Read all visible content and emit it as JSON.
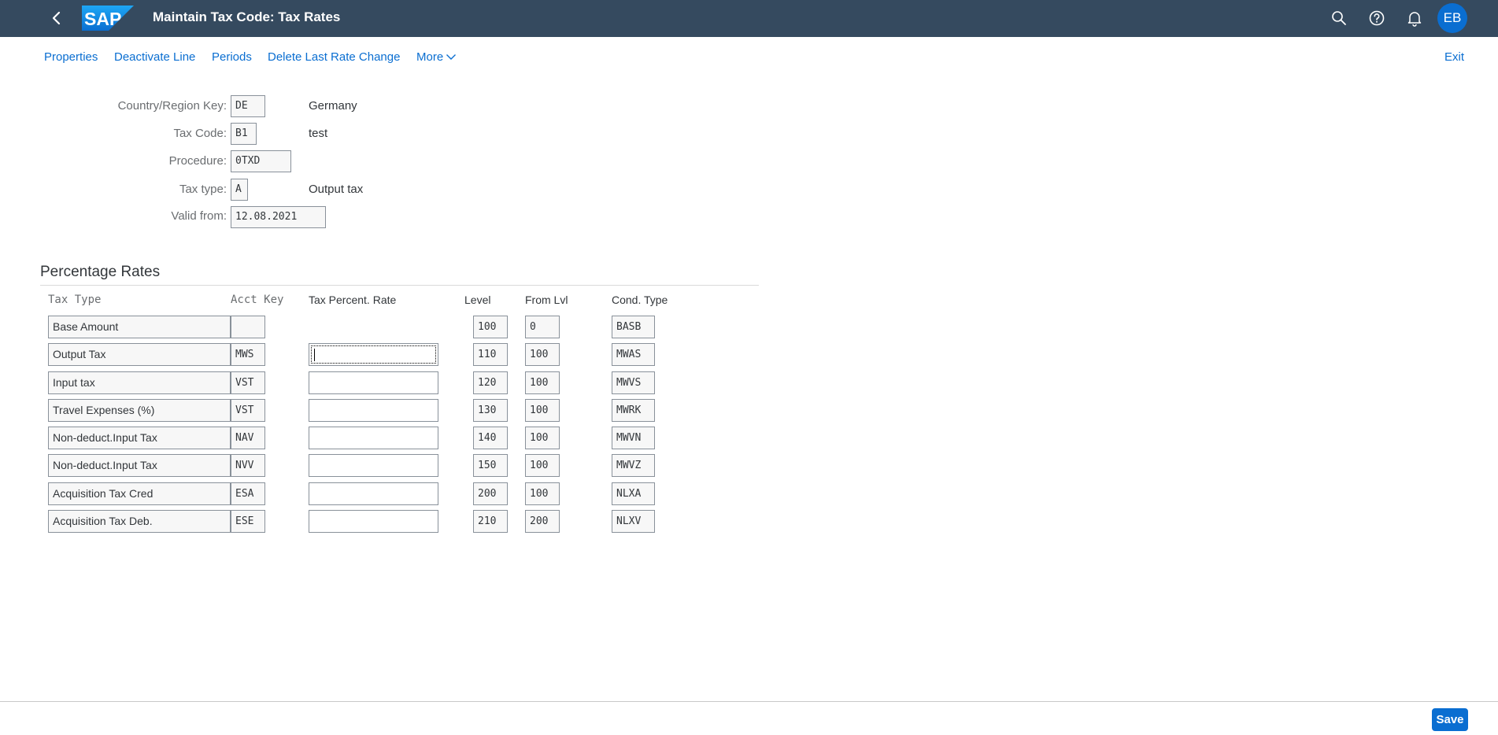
{
  "shell": {
    "title": "Maintain Tax Code: Tax Rates",
    "logo_text": "SAP",
    "avatar_initials": "EB",
    "icons": [
      "back-icon",
      "search-icon",
      "help-icon",
      "notification-icon"
    ],
    "colors": {
      "shellbar": "#354a5f",
      "accent": "#0a6ed1"
    }
  },
  "toolbar": {
    "properties": "Properties",
    "deactivate_line": "Deactivate Line",
    "periods": "Periods",
    "delete_last_rate_change": "Delete Last Rate Change",
    "more": "More",
    "exit": "Exit"
  },
  "header": {
    "country_label": "Country/Region Key:",
    "country_value": "DE",
    "country_desc": "Germany",
    "tax_code_label": "Tax Code:",
    "tax_code_value": "B1",
    "tax_code_desc": "test",
    "procedure_label": "Procedure:",
    "procedure_value": "0TXD",
    "tax_type_label": "Tax type:",
    "tax_type_value": "A",
    "tax_type_desc": "Output tax",
    "valid_from_label": "Valid from:",
    "valid_from_value": "12.08.2021"
  },
  "rates": {
    "section_title": "Percentage Rates",
    "columns": {
      "tax_type": "Tax Type",
      "acct_key": "Acct Key",
      "rate": "Tax Percent. Rate",
      "level": "Level",
      "from_lvl": "From Lvl",
      "cond_type": "Cond. Type"
    },
    "rows": [
      {
        "tax_type": "Base Amount",
        "acct_key": "",
        "rate": "",
        "level": "100",
        "from_lvl": "0",
        "cond_type": "BASB"
      },
      {
        "tax_type": "Output Tax",
        "acct_key": "MWS",
        "rate": "",
        "level": "110",
        "from_lvl": "100",
        "cond_type": "MWAS"
      },
      {
        "tax_type": "Input tax",
        "acct_key": "VST",
        "rate": "",
        "level": "120",
        "from_lvl": "100",
        "cond_type": "MWVS"
      },
      {
        "tax_type": "Travel Expenses (%)",
        "acct_key": "VST",
        "rate": "",
        "level": "130",
        "from_lvl": "100",
        "cond_type": "MWRK"
      },
      {
        "tax_type": "Non-deduct.Input Tax",
        "acct_key": "NAV",
        "rate": "",
        "level": "140",
        "from_lvl": "100",
        "cond_type": "MWVN"
      },
      {
        "tax_type": "Non-deduct.Input Tax",
        "acct_key": "NVV",
        "rate": "",
        "level": "150",
        "from_lvl": "100",
        "cond_type": "MWVZ"
      },
      {
        "tax_type": "Acquisition Tax Cred",
        "acct_key": "ESA",
        "rate": "",
        "level": "200",
        "from_lvl": "100",
        "cond_type": "NLXA"
      },
      {
        "tax_type": "Acquisition Tax Deb.",
        "acct_key": "ESE",
        "rate": "",
        "level": "210",
        "from_lvl": "200",
        "cond_type": "NLXV"
      }
    ]
  },
  "footer": {
    "save": "Save"
  }
}
